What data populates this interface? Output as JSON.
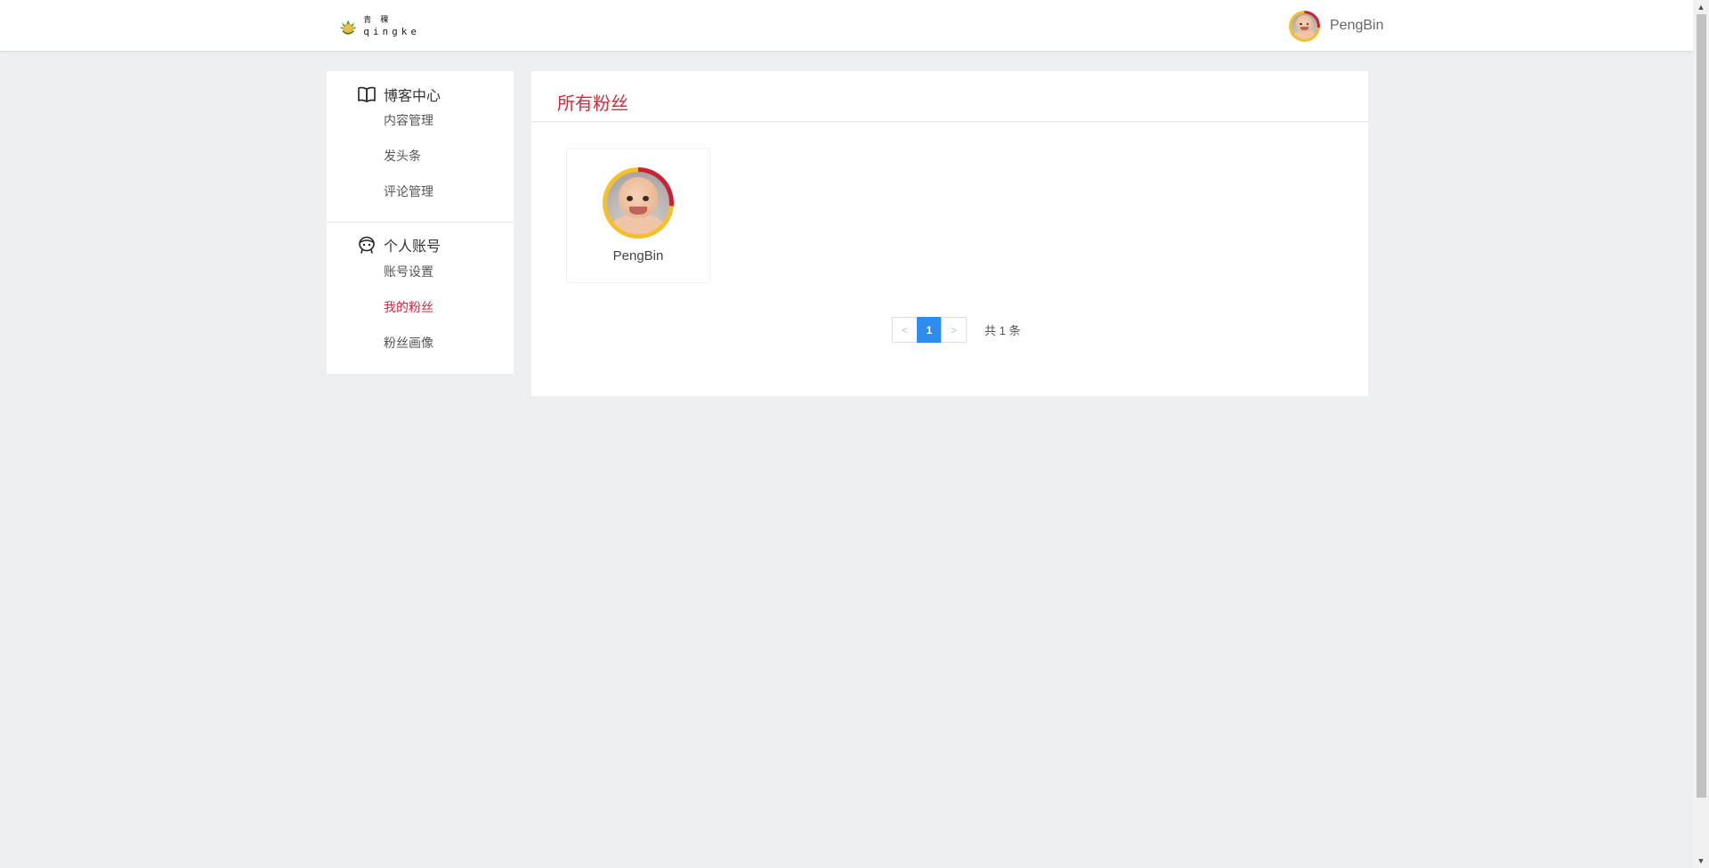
{
  "header": {
    "logo": {
      "cn": "青稞",
      "en": "qingke"
    },
    "user_name": "PengBin"
  },
  "sidebar": {
    "groups": [
      {
        "icon": "book-icon",
        "title": "博客中心",
        "items": [
          {
            "label": "内容管理",
            "active": false
          },
          {
            "label": "发头条",
            "active": false
          },
          {
            "label": "评论管理",
            "active": false
          }
        ]
      },
      {
        "icon": "account-face-icon",
        "title": "个人账号",
        "items": [
          {
            "label": "账号设置",
            "active": false
          },
          {
            "label": "我的粉丝",
            "active": true
          },
          {
            "label": "粉丝画像",
            "active": false
          }
        ]
      }
    ]
  },
  "main": {
    "title": "所有粉丝",
    "fans": [
      {
        "name": "PengBin"
      }
    ],
    "pagination": {
      "prev": "<",
      "current": "1",
      "next": ">",
      "total_text": "共 1 条"
    }
  },
  "colors": {
    "accent": "#cf2a3e",
    "page_button": "#2d8cf0",
    "background": "#eeeff1"
  }
}
